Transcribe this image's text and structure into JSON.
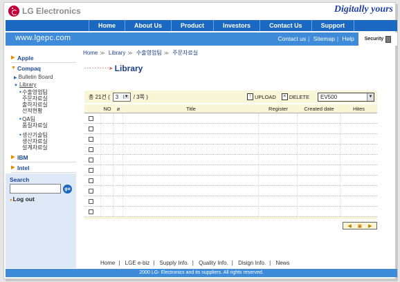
{
  "brand": {
    "logo_text": "LG Electronics",
    "slogan": "Digitally yours"
  },
  "topnav": [
    "Home",
    "About Us",
    "Product",
    "Investors",
    "Contact Us",
    "Support"
  ],
  "subbar": {
    "url": "www.lgepc.com",
    "links": [
      "Contact us",
      "Sitemap",
      "Help"
    ],
    "security_label": "Security"
  },
  "sidebar": {
    "apple": "Apple",
    "compaq": "Compaq",
    "bulletin": "Bulletin Board",
    "library": "Library",
    "groups": [
      {
        "head": "수출영업팀",
        "items": [
          "주문자료실",
          "출하자료실",
          "선적현황"
        ]
      },
      {
        "head": "QA팀",
        "items": [
          "품질자료실"
        ]
      },
      {
        "head": "생산기술팀",
        "items": [
          "생산자료실",
          "설계자료실"
        ]
      }
    ],
    "ibm": "IBM",
    "intel": "Intel",
    "search_label": "Search",
    "go": "go",
    "logout": "Log out"
  },
  "breadcrumb": [
    "Home",
    "Library",
    "수출영업팀",
    "주문자료실"
  ],
  "page_title": "Library",
  "toolbar": {
    "total_prefix": "총 21건 (",
    "page_value": "3",
    "page_suffix": "/ 3쪽 )",
    "upload": "UPLOAD",
    "delete": "DELETE",
    "model": "EV500"
  },
  "table": {
    "headers": {
      "no": "NO",
      "title": "Title",
      "register": "Register",
      "created": "Created date",
      "hits": "Hites"
    },
    "rows": 10
  },
  "footer": {
    "links": [
      "Home",
      "LGE e-biz",
      "Supply Info.",
      "Quality Info.",
      "Disign Info.",
      "News"
    ],
    "copyright": "2000 LG- Electronics and its suppliers. All rights reserved."
  },
  "colors": {
    "nav": "#1a68c2",
    "subbar": "#3d8bd9",
    "toolbar": "#f8f6d6",
    "title": "#1a3f8a"
  }
}
